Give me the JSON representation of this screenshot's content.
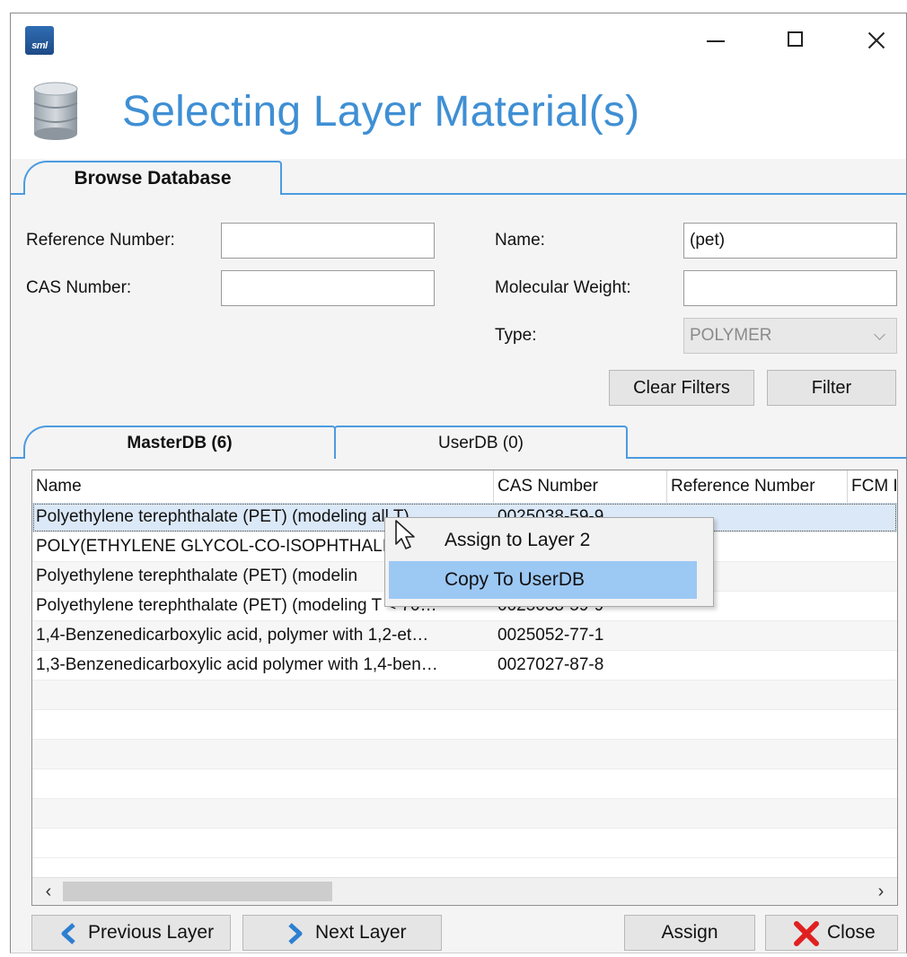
{
  "window": {
    "app_icon_text": "sml",
    "title": "Selecting Layer Material(s)"
  },
  "top_tab": {
    "label": "Browse Database"
  },
  "form": {
    "reference_number": {
      "label": "Reference Number:",
      "value": ""
    },
    "cas_number": {
      "label": "CAS Number:",
      "value": ""
    },
    "name": {
      "label": "Name:",
      "value": "(pet)"
    },
    "molecular_weight": {
      "label": "Molecular Weight:",
      "value": ""
    },
    "type": {
      "label": "Type:",
      "value": "POLYMER"
    },
    "clear_filters_label": "Clear Filters",
    "filter_label": "Filter"
  },
  "db_tabs": [
    {
      "label": "MasterDB (6)",
      "active": true
    },
    {
      "label": "UserDB (0)",
      "active": false
    }
  ],
  "table": {
    "columns": [
      "Name",
      "CAS Number",
      "Reference Number",
      "FCM I"
    ],
    "rows": [
      {
        "name": "Polyethylene terephthalate (PET) (modeling all T)",
        "cas": "0025038-59-9",
        "ref": "",
        "fcm": ""
      },
      {
        "name": "POLY(ETHYLENE GLYCOL-CO-ISOPHTHALI",
        "cas": "",
        "ref": "",
        "fcm": ""
      },
      {
        "name": "Polyethylene terephthalate (PET) (modelin",
        "cas": "",
        "ref": "",
        "fcm": ""
      },
      {
        "name": "Polyethylene terephthalate (PET) (modeling T < 70…",
        "cas": "0025038-59-9",
        "ref": "",
        "fcm": ""
      },
      {
        "name": "1,4-Benzenedicarboxylic acid, polymer with 1,2-et…",
        "cas": "0025052-77-1",
        "ref": "",
        "fcm": ""
      },
      {
        "name": "1,3-Benzenedicarboxylic acid polymer with 1,4-ben…",
        "cas": "0027027-87-8",
        "ref": "",
        "fcm": ""
      }
    ]
  },
  "context_menu": {
    "items": [
      {
        "label": "Assign to Layer 2",
        "highlighted": false
      },
      {
        "label": "Copy To UserDB",
        "highlighted": true
      }
    ]
  },
  "footer": {
    "previous_layer_label": "Previous Layer",
    "next_layer_label": "Next Layer",
    "assign_label": "Assign",
    "close_label": "Close"
  },
  "colors": {
    "title_blue": "#3f8fd4",
    "tab_border": "#4d9be0",
    "menu_highlight": "#9cc8f4",
    "nav_chevron": "#2d7fd1",
    "close_x": "#e02020"
  },
  "icons": [
    "app-logo-icon",
    "minimize-icon",
    "maximize-icon",
    "close-window-icon",
    "database-icon",
    "chevron-left-icon",
    "chevron-right-icon",
    "close-x-icon",
    "mouse-cursor-icon"
  ]
}
